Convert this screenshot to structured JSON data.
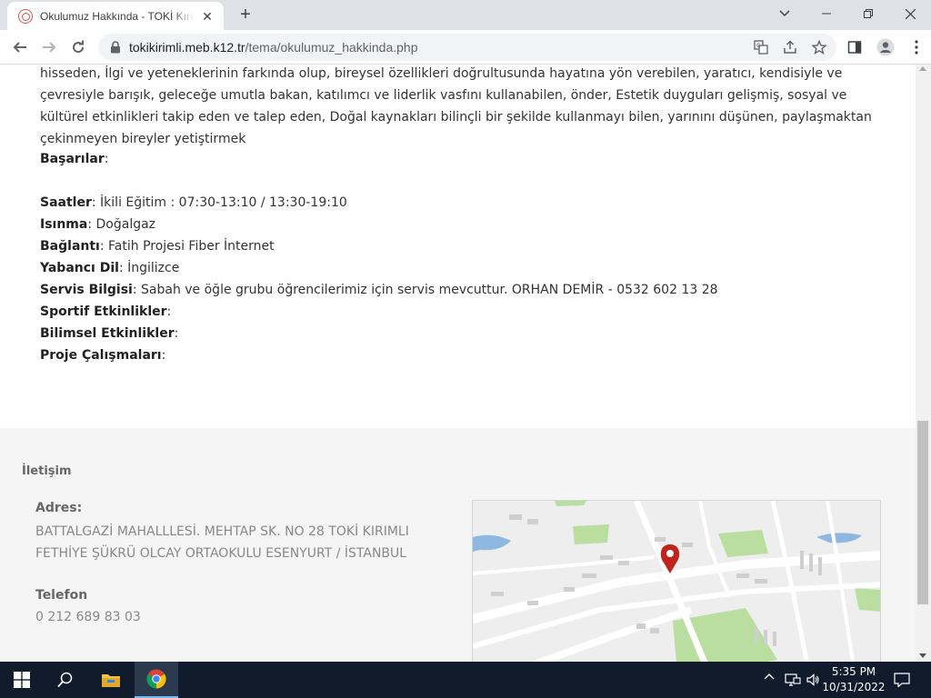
{
  "browser": {
    "tab_title": "Okulumuz Hakkında - TOKİ Kırım",
    "url_domain": "tokikirimli.meb.k12.tr",
    "url_path": "/tema/okulumuz_hakkinda.php"
  },
  "page": {
    "intro_paragraph": "hisseden, İlgi ve yeteneklerinin farkında olup, bireysel özellikleri doğrultusunda hayatına yön verebilen, yaratıcı, kendisiyle ve çevresiyle barışık, geleceğe umutla bakan, katılımcı ve liderlik vasfını kullanabilen, önder, Estetik duyguları gelişmiş, sosyal ve kültürel etkinlikleri takip eden ve talep eden, Doğal kaynakları bilinçli bir şekilde kullanmayı bilen, yarınını düşünen, paylaşmaktan çekinmeyen bireyler yetiştirmek",
    "info": [
      {
        "label": "Başarılar",
        "value": ""
      },
      {
        "label": "Saatler",
        "value": "İkili Eğitim : 07:30-13:10 / 13:30-19:10"
      },
      {
        "label": "Isınma",
        "value": "Doğalgaz"
      },
      {
        "label": "Bağlantı",
        "value": "Fatih Projesi Fiber İnternet"
      },
      {
        "label": "Yabancı Dil",
        "value": "İngilizce"
      },
      {
        "label": "Servis Bilgisi",
        "value": "Sabah ve öğle grubu öğrencilerimiz için servis mevcuttur. ORHAN DEMİR - 0532 602 13 28"
      },
      {
        "label": "Sportif Etkinlikler",
        "value": ""
      },
      {
        "label": "Bilimsel Etkinlikler",
        "value": ""
      },
      {
        "label": "Proje Çalışmaları",
        "value": ""
      }
    ]
  },
  "footer": {
    "title": "İletişim",
    "address_label": "Adres:",
    "address": "BATTALGAZİ MAHALLLESİ. MEHTAP SK. NO 28 TOKİ KIRIMLI FETHİYE ŞÜKRÜ OLCAY ORTAOKULU ESENYURT / İSTANBUL",
    "phone_label": "Telefon",
    "phone": "0 212 689 83 03"
  },
  "taskbar": {
    "time": "5:35 PM",
    "date": "10/31/2022"
  },
  "colors": {
    "map_pin": "#c0221e",
    "map_park": "#b9dea0",
    "map_water": "#8fb8e0",
    "taskbar_bg": "#101c2c"
  },
  "icons": [
    "favicon-icon",
    "close-icon",
    "plus-icon",
    "chevron-down-icon",
    "minimize-icon",
    "restore-icon",
    "back-icon",
    "forward-icon",
    "reload-icon",
    "lock-icon",
    "translate-icon",
    "share-icon",
    "star-icon",
    "side-panel-icon",
    "profile-icon",
    "menu-icon",
    "windows-start-icon",
    "search-icon",
    "file-explorer-icon",
    "chrome-icon",
    "chevron-up-icon",
    "network-icon",
    "volume-icon",
    "notification-icon",
    "map-pin-icon"
  ]
}
